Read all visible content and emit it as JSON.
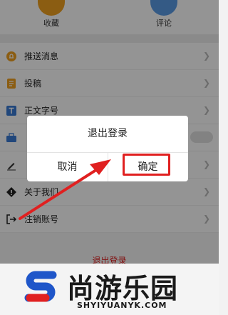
{
  "top": {
    "favorites_label": "收藏",
    "comments_label": "评论",
    "favorites_color": "#f0a020",
    "comments_color": "#5b9be6"
  },
  "menu": {
    "items": [
      {
        "label": "推送消息",
        "icon": "bell-icon"
      },
      {
        "label": "投稿",
        "icon": "document-icon"
      },
      {
        "label": "正文字号",
        "icon": "text-size-icon"
      },
      {
        "label": "",
        "icon": "eye-protect-icon"
      },
      {
        "label": "",
        "icon": "pencil-icon"
      },
      {
        "label": "关于我们",
        "icon": "info-icon"
      },
      {
        "label": "注销账号",
        "icon": "logout-icon"
      }
    ],
    "logout_button": "退出登录"
  },
  "dialog": {
    "title": "退出登录",
    "cancel": "取消",
    "confirm": "确定"
  },
  "annotation_color": "#e02020",
  "watermark": {
    "name": "尚游乐园",
    "domain": "SHYIYUANYK.COM"
  }
}
